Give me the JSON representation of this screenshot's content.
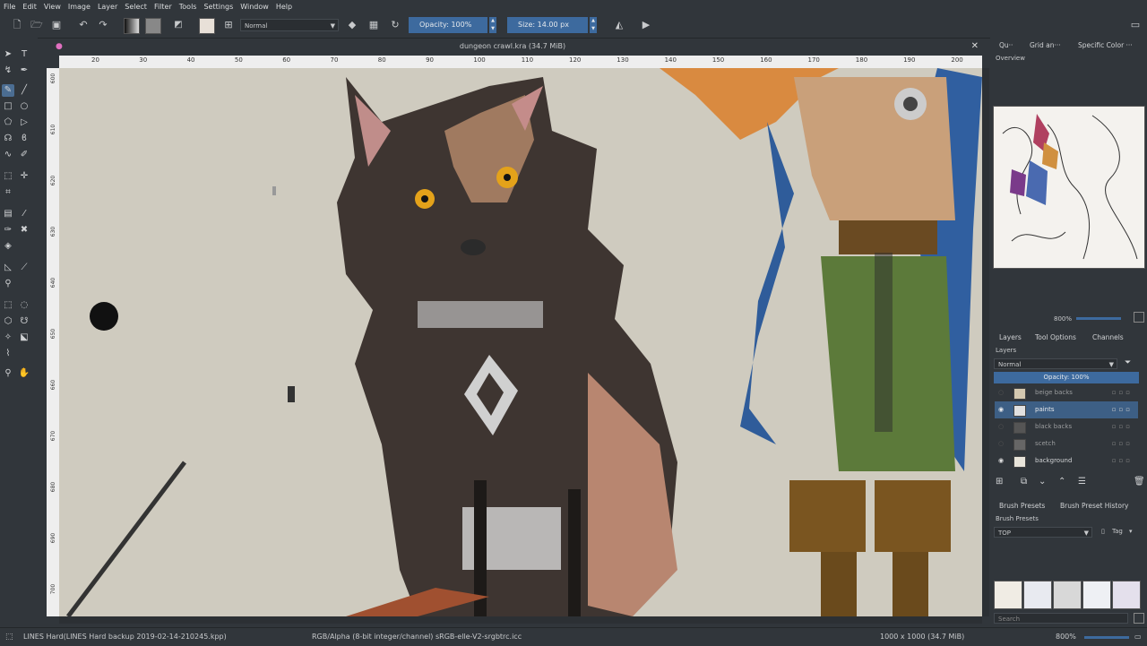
{
  "menu": [
    "File",
    "Edit",
    "View",
    "Image",
    "Layer",
    "Select",
    "Filter",
    "Tools",
    "Settings",
    "Window",
    "Help"
  ],
  "toolbar": {
    "blend_mode": "Normal",
    "opacity_label": "Opacity:",
    "opacity_value": "100%",
    "size_label": "Size:",
    "size_value": "14.00 px"
  },
  "document": {
    "title": "dungeon crawl.kra (34.7 MiB)"
  },
  "ruler": {
    "h_ticks": [
      "20",
      "30",
      "40",
      "50",
      "60",
      "70",
      "80",
      "90",
      "100",
      "110",
      "120",
      "130",
      "140",
      "150",
      "160",
      "170",
      "180",
      "190",
      "200"
    ],
    "v_ticks": [
      "600",
      "610",
      "620",
      "630",
      "640",
      "650",
      "660",
      "670",
      "680",
      "690",
      "700"
    ]
  },
  "dock": {
    "top_tabs": [
      "Qu··",
      "Grid an···",
      "Specific Color ···"
    ],
    "overview_label": "Overview",
    "zoom_value": "800%",
    "layer_tabs": [
      "Layers",
      "Tool Options",
      "Channels"
    ],
    "layers_label": "Layers",
    "layers_blend": "Normal",
    "layers_opacity": "Opacity:  100%",
    "layers": [
      {
        "name": "beige backs",
        "visible": false,
        "selected": false
      },
      {
        "name": "paints",
        "visible": true,
        "selected": true
      },
      {
        "name": "black backs",
        "visible": false,
        "selected": false
      },
      {
        "name": "scetch",
        "visible": false,
        "selected": false
      },
      {
        "name": "background",
        "visible": true,
        "selected": false
      }
    ],
    "brush_tabs": [
      "Brush Presets",
      "Brush Preset History"
    ],
    "brush_presets_label": "Brush Presets",
    "preset_filter": "TOP",
    "tag_label": "Tag",
    "search_placeholder": "Search"
  },
  "status": {
    "brush": "LINES Hard(LINES Hard backup 2019-02-14-210245.kpp)",
    "color_space": "RGB/Alpha (8-bit integer/channel)  sRGB-elle-V2-srgbtrc.icc",
    "dimensions": "1000 x 1000 (34.7 MiB)",
    "zoom": "800%"
  },
  "colors": {
    "accent": "#3d6a9e",
    "canvas_bg": "#cfcbbf",
    "ui_bg": "#31363b"
  }
}
